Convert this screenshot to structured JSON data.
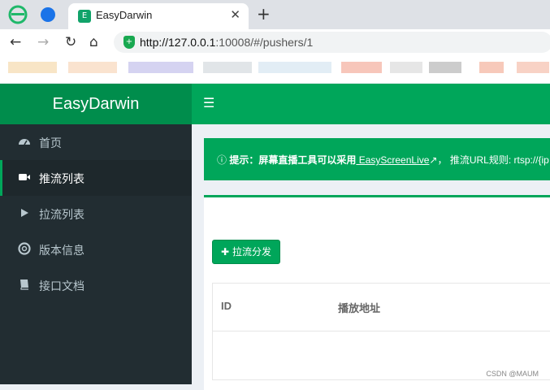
{
  "browser": {
    "tab_title": "EasyDarwin",
    "tab_favicon_letter": "E",
    "url_host": "http://127.0.0.1",
    "url_rest": ":10008/#/pushers/1",
    "colors": {
      "tab_favicon": "#11a36a",
      "shield": "#18a850"
    }
  },
  "app": {
    "logo_text": "EasyDarwin",
    "colors": {
      "header": "#00a65a",
      "logo_bg": "#008d4c",
      "sidebar": "#222d32"
    }
  },
  "sidebar": {
    "items": [
      {
        "label": "首页",
        "icon": "dashboard-icon",
        "active": false
      },
      {
        "label": "推流列表",
        "icon": "video-camera-icon",
        "active": true
      },
      {
        "label": "拉流列表",
        "icon": "play-icon",
        "active": false
      },
      {
        "label": "版本信息",
        "icon": "life-ring-icon",
        "active": false
      },
      {
        "label": "接口文档",
        "icon": "book-icon",
        "active": false
      }
    ]
  },
  "callout": {
    "prefix": "提示：屏幕直播工具可以采用",
    "link": " EasyScreenLive",
    "suffix": "， 推流URL规则: rtsp://{ip"
  },
  "content": {
    "add_button_label": "拉流分发",
    "table_headers": [
      "ID",
      "播放地址"
    ]
  },
  "watermark": "CSDN @MAUM"
}
